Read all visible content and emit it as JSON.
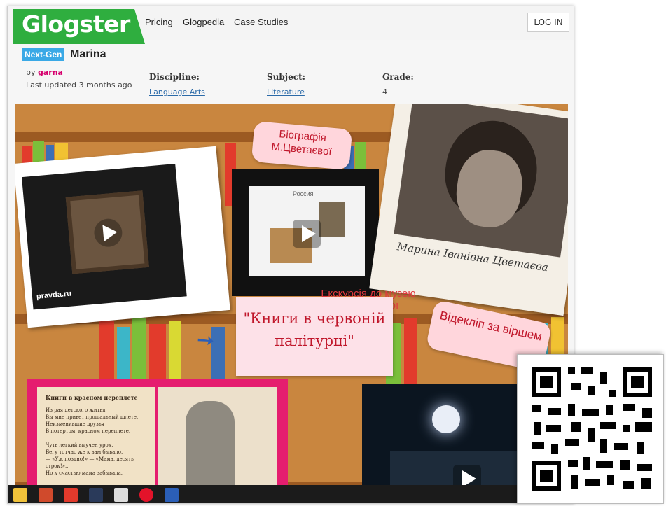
{
  "header": {
    "logo_text": "Glogster",
    "nav": [
      "Pricing",
      "Glogpedia",
      "Case Studies"
    ],
    "login_label": "LOG IN"
  },
  "glog": {
    "badge": "Next-Gen",
    "title": "Marina",
    "by_prefix": "by",
    "author": "garna",
    "updated": "Last updated 3 months ago",
    "discipline_label": "Discipline:",
    "discipline_value": "Language Arts",
    "subject_label": "Subject:",
    "subject_value": "Literature",
    "grade_label": "Grade:",
    "grade_value": "4"
  },
  "canvas": {
    "sticky_bio": "Біографія М.Цветаєвої",
    "portrait_caption": "Марина Іванівна Цветаєва",
    "slide_title": "Россия",
    "excursion": "Екскурсія до музею М.Цветаєвої",
    "book_title": "\"Книги в червоній палітурці\"",
    "videoclip": "Відекліп за віршем",
    "pravda": "pravda.ru",
    "poem_title": "Книги в красном переплете",
    "poem_lines": [
      "Из рая детского житья",
      "Вы мне привет прощальный шлете,",
      "Неизменившие друзья",
      "В потертом, красном переплете.",
      "",
      "Чуть легкий выучен урок,",
      "Бегу тотчас же к вам бывало.",
      "— «Уж поздно!» — «Мама, десять строк!»...",
      "Но к счастью мама забывала."
    ]
  },
  "colors": {
    "logo_green": "#2fae3f",
    "badge_blue": "#3aa9e6",
    "author_pink": "#d6006d",
    "sticky_pink": "#ffd6dc",
    "sticky_text_red": "#c0162a"
  },
  "icons": [
    "play-icon",
    "arrow-icon",
    "qr-code"
  ]
}
